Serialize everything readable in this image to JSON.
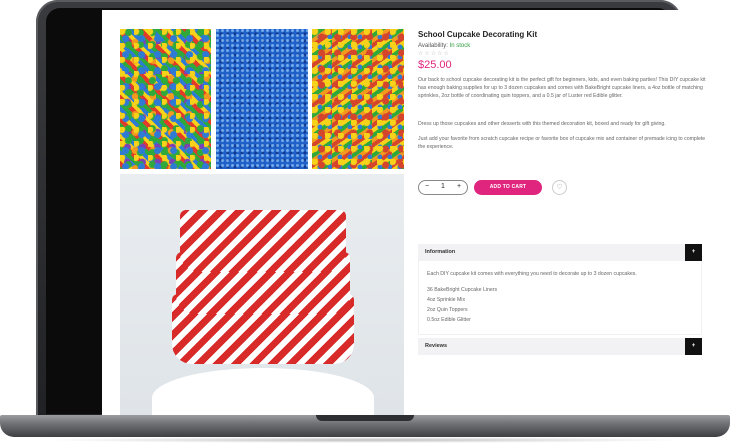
{
  "product": {
    "title": "School Cupcake Decorating Kit",
    "availability_label": "Availability:",
    "availability_value": "In stock",
    "rating_stars": "☆☆☆☆☆",
    "price": "$25.00",
    "description": [
      "Our back to school cupcake decorating kit is the perfect gift for beginners, kids, and even baking parties! This DIY cupcake kit has enough baking supplies for up to 3 dozen cupcakes and comes with BakeBright cupcake liners, a 4oz bottle of matching sprinkles, 2oz bottle of coordinating quin toppers, and a 0.5 jar of Luster red Edible glitter.",
      "Dress up those cupcakes and other desserts with this themed decoration kit, boxed and ready for gift giving.",
      "Just add your favorite from scratch cupcake recipe or favorite box of cupcake mix and container of premade icing to complete the experience."
    ]
  },
  "purchase": {
    "minus": "−",
    "quantity": "1",
    "plus": "+",
    "add_to_cart": "ADD TO CART",
    "wishlist_icon": "♡"
  },
  "accordion": {
    "information": {
      "label": "Information",
      "toggle": "+",
      "text": "Each DIY cupcake kit comes with everything you need to decorate up to 3 dozen cupcakes.",
      "items": [
        "36 BakeBright Cupcake Liners",
        "4oz Sprinkle Mix",
        "2oz Quin Toppers",
        "0.5oz Edible Glitter"
      ]
    },
    "reviews": {
      "label": "Reviews",
      "toggle": "+"
    }
  },
  "colors": {
    "accent": "#e0257f",
    "in_stock": "#2e9d3a",
    "toggle_bg": "#111111"
  }
}
